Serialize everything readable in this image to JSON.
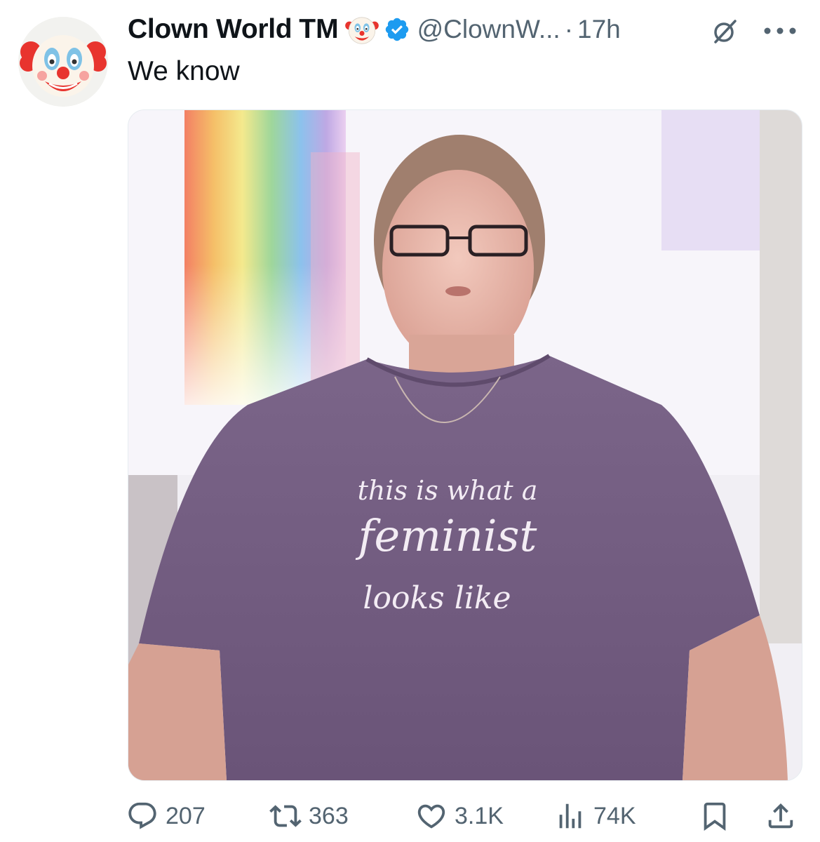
{
  "tweet": {
    "display_name": "Clown World",
    "trademark": "TM",
    "handle": "@ClownW...",
    "separator": "·",
    "time": "17h",
    "text": "We know",
    "verified": true,
    "name_emoji": "clown-face-icon",
    "avatar": "clown-face-icon"
  },
  "media": {
    "shirt_text": {
      "line1": "this is what a",
      "line2": "feminist",
      "line3": "looks like"
    }
  },
  "actions": {
    "replies": "207",
    "reposts": "363",
    "likes": "3.1K",
    "views": "74K"
  },
  "colors": {
    "text": "#0f1419",
    "secondary": "#536471",
    "verified": "#1d9bf0",
    "shirt": "#725d80"
  },
  "icons": [
    "reply-icon",
    "repost-icon",
    "like-icon",
    "views-icon",
    "bookmark-icon",
    "share-icon",
    "grok-icon",
    "more-icon"
  ]
}
